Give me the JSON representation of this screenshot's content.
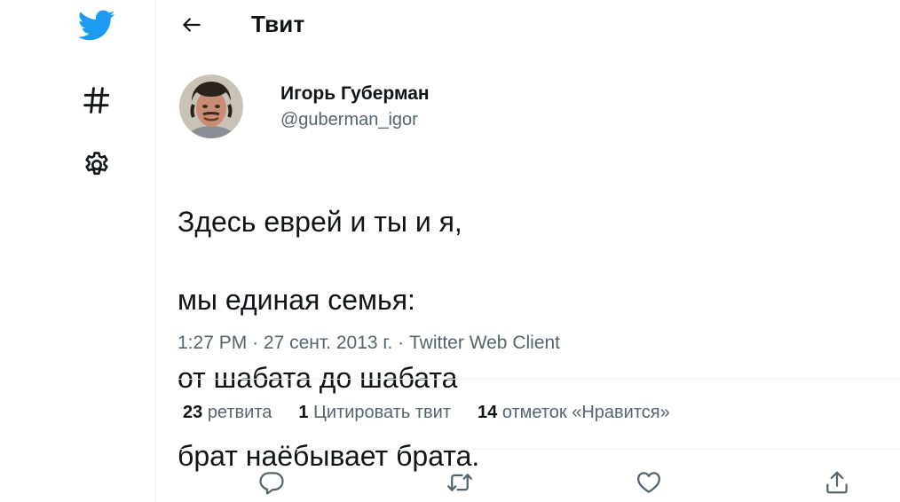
{
  "colors": {
    "twitter_blue": "#1d9bf0",
    "text_primary": "#0f1419",
    "text_secondary": "#536471",
    "divider": "#eff3f4"
  },
  "nav": {
    "items": [
      {
        "icon": "twitter-bird-icon"
      },
      {
        "icon": "hashtag-icon"
      },
      {
        "icon": "gear-icon"
      }
    ]
  },
  "header": {
    "back_icon": "arrow-left-icon",
    "title": "Твит"
  },
  "tweet": {
    "author_name": "Игорь Губерман",
    "author_handle": "@guberman_igor",
    "lines": [
      "Здесь еврей и ты и я,",
      "мы единая семья:",
      "от шабата до шабата",
      "брат наёбывает брата."
    ],
    "time": "1:27 PM",
    "separator": "·",
    "date": "27 сент. 2013 г.",
    "source": "Twitter Web Client"
  },
  "stats": {
    "retweets": {
      "count": "23",
      "label": "ретвита"
    },
    "quotes": {
      "count": "1",
      "label": "Цитировать твит"
    },
    "likes": {
      "count": "14",
      "label": "отметок «Нравится»"
    }
  },
  "actions": [
    {
      "icon": "reply-icon"
    },
    {
      "icon": "retweet-icon"
    },
    {
      "icon": "like-icon"
    },
    {
      "icon": "share-icon"
    }
  ]
}
